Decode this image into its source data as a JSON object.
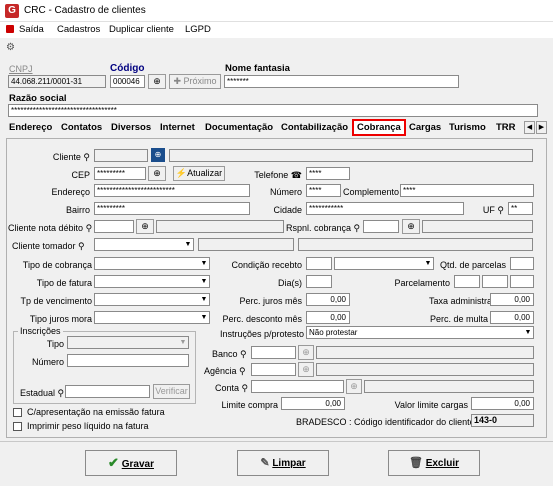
{
  "window": {
    "title": "CRC - Cadastro de clientes"
  },
  "menu": [
    "Saída",
    "Cadastros",
    "Duplicar cliente",
    "LGPD"
  ],
  "header": {
    "cnpj_label": "CNPJ",
    "cnpj_value": "44.068.211/0001-31",
    "codigo_label": "Código",
    "codigo_value": "000046",
    "proximo_label": "Próximo",
    "nome_fantasia_label": "Nome fantasia",
    "nome_fantasia_value": "*******",
    "razao_social_label": "Razão social",
    "razao_social_value": "**********************************"
  },
  "tabs": [
    "Endereço",
    "Contatos",
    "Diversos",
    "Internet",
    "Documentação",
    "Contabilização",
    "Cobrança",
    "Cargas",
    "Turismo",
    "TRR"
  ],
  "form": {
    "cliente_label": "Cliente",
    "cep_label": "CEP",
    "cep_value": "*********",
    "atualizar_label": "Atualizar",
    "telefone_label": "Telefone",
    "telefone_value": "****",
    "endereco_label": "Endereço",
    "endereco_value": "*************************",
    "numero_label": "Número",
    "numero_value": "****",
    "complemento_label": "Complemento",
    "complemento_value": "****",
    "bairro_label": "Bairro",
    "bairro_value": "*********",
    "cidade_label": "Cidade",
    "cidade_value": "***********",
    "uf_label": "UF",
    "uf_value": "**",
    "cliente_nota_debito_label": "Cliente nota débito",
    "rspnl_cobranca_label": "Rspnl. cobrança",
    "cliente_tomador_label": "Cliente tomador",
    "tipo_cobranca_label": "Tipo de cobrança",
    "condicao_recebto_label": "Condição recebto",
    "qtd_parcelas_label": "Qtd. de parcelas",
    "tipo_fatura_label": "Tipo de fatura",
    "dias_label": "Dia(s)",
    "parcelamento_label": "Parcelamento",
    "tp_vencimento_label": "Tp de vencimento",
    "perc_juros_label": "Perc. juros mês",
    "perc_juros_value": "0,00",
    "taxa_adm_label": "Taxa administrativa",
    "taxa_adm_value": "0,00",
    "tipo_juros_mora_label": "Tipo juros mora",
    "perc_desconto_label": "Perc. desconto mês",
    "perc_desconto_value": "0,00",
    "perc_multa_label": "Perc. de multa",
    "perc_multa_value": "0,00",
    "inscricoes_label": "Inscrições",
    "tipo_label": "Tipo",
    "numero2_label": "Número",
    "instrucoes_label": "Instruções p/protesto",
    "instrucoes_value": "Não protestar",
    "banco_label": "Banco",
    "agencia_label": "Agência",
    "conta_label": "Conta",
    "estadual_label": "Estadual",
    "verificar_label": "Verificar",
    "limite_compra_label": "Limite compra",
    "limite_compra_value": "0,00",
    "valor_limite_cargas_label": "Valor limite cargas",
    "valor_limite_cargas_value": "0,00",
    "c_apresentacao_label": "C/apresentação na emissão fatura",
    "imprimir_peso_label": "Imprimir peso líquido na fatura",
    "bradesco_label": "BRADESCO : Código identificador do cliente",
    "bradesco_value": "143-0"
  },
  "buttons": {
    "gravar": "Gravar",
    "limpar": "Limpar",
    "excluir": "Excluir"
  }
}
